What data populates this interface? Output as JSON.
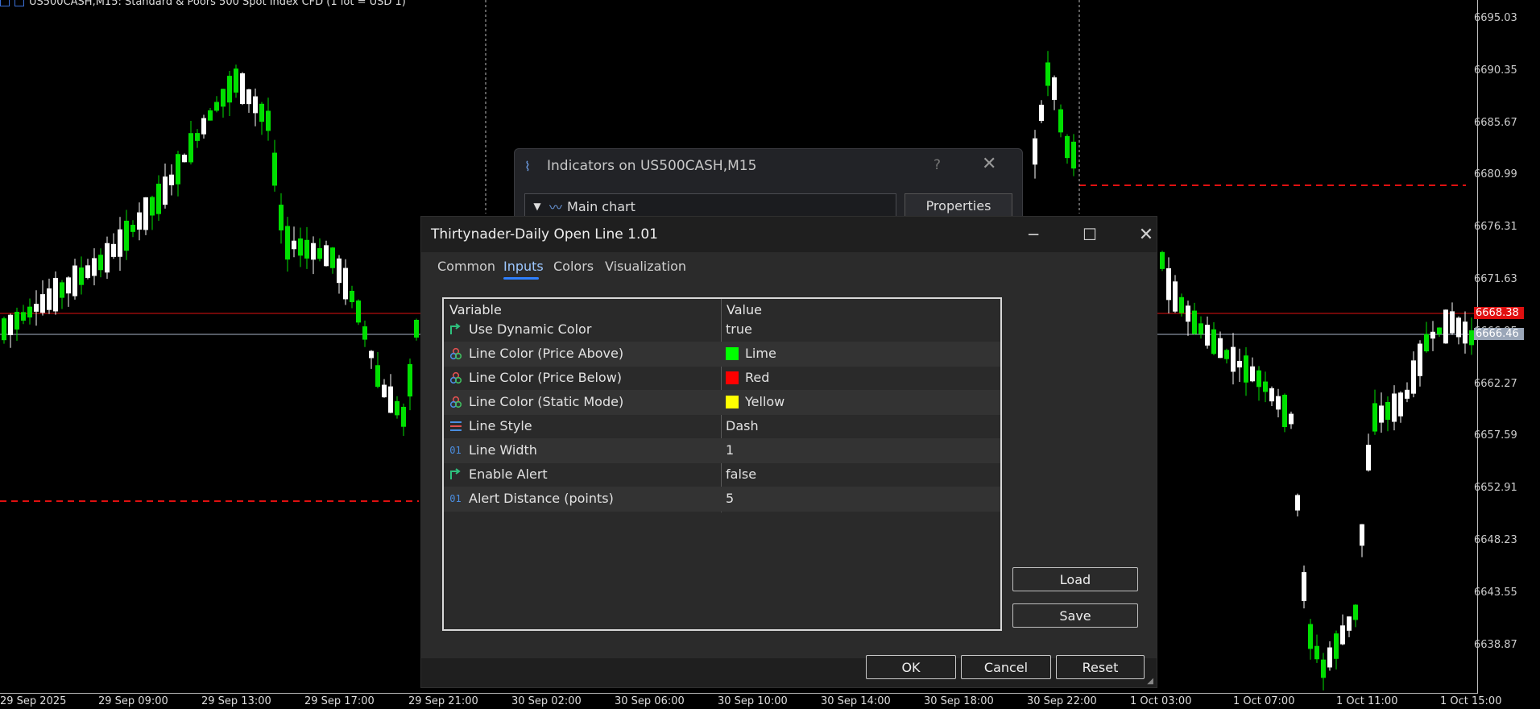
{
  "chart": {
    "title": "US500CASH,M15:  Standard & Poors 500 Spot Index CFD (1 lot = USD 1)",
    "price_axis": [
      "6695.03",
      "6690.35",
      "6685.67",
      "6680.99",
      "6676.31",
      "6671.63",
      "6666.95",
      "6662.27",
      "6657.59",
      "6652.91",
      "6648.23",
      "6643.55",
      "6638.87"
    ],
    "price_tags": {
      "red": "6668.38",
      "grey": "6666.46"
    },
    "time_axis": [
      "29 Sep 2025",
      "29 Sep 09:00",
      "29 Sep 13:00",
      "29 Sep 17:00",
      "29 Sep 21:00",
      "30 Sep 02:00",
      "30 Sep 06:00",
      "30 Sep 10:00",
      "30 Sep 14:00",
      "30 Sep 18:00",
      "30 Sep 22:00",
      "1 Oct 03:00",
      "1 Oct 07:00",
      "1 Oct 11:00",
      "1 Oct 15:00"
    ],
    "colors": {
      "bull": "#00e000",
      "bear": "#ffffff",
      "red_line": "#e01010",
      "grey_line": "#aab4c8"
    }
  },
  "back_window": {
    "title": "Indicators on US500CASH,M15",
    "help": "?",
    "selector": "Main chart",
    "properties_button": "Properties"
  },
  "dialog": {
    "title": "Thirtynader-Daily Open Line 1.01",
    "tabs": [
      "Common",
      "Inputs",
      "Colors",
      "Visualization"
    ],
    "active_tab": "Inputs",
    "headers": {
      "variable": "Variable",
      "value": "Value"
    },
    "rows": [
      {
        "icon": "bool-icon",
        "variable": "Use Dynamic Color",
        "value": "true"
      },
      {
        "icon": "color-icon",
        "variable": "Line Color (Price Above)",
        "value": "Lime",
        "swatch": "#00ff00"
      },
      {
        "icon": "color-icon",
        "variable": "Line Color (Price Below)",
        "value": "Red",
        "swatch": "#ff0000"
      },
      {
        "icon": "color-icon",
        "variable": "Line Color (Static Mode)",
        "value": "Yellow",
        "swatch": "#ffff00"
      },
      {
        "icon": "style-icon",
        "variable": "Line Style",
        "value": "Dash"
      },
      {
        "icon": "int-icon",
        "variable": "Line Width",
        "value": "1"
      },
      {
        "icon": "bool-icon",
        "variable": "Enable Alert",
        "value": "false"
      },
      {
        "icon": "int-icon",
        "variable": "Alert Distance (points)",
        "value": "5"
      }
    ],
    "load_button": "Load",
    "save_button": "Save",
    "ok_button": "OK",
    "cancel_button": "Cancel",
    "reset_button": "Reset"
  }
}
